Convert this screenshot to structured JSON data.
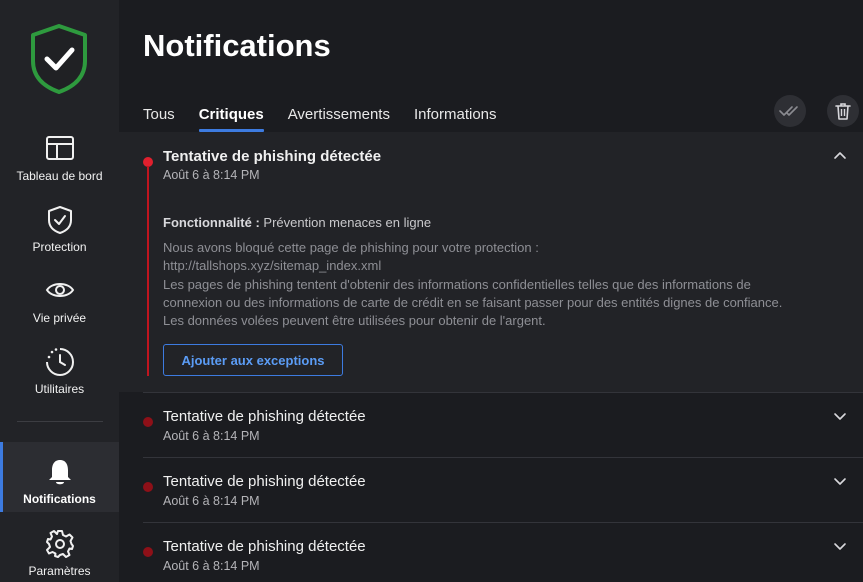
{
  "sidebar": {
    "items": [
      {
        "label": "Tableau de bord",
        "icon": "dashboard-icon"
      },
      {
        "label": "Protection",
        "icon": "shield-check-icon"
      },
      {
        "label": "Vie privée",
        "icon": "eye-icon"
      },
      {
        "label": "Utilitaires",
        "icon": "clock-tools-icon"
      },
      {
        "label": "Notifications",
        "icon": "bell-icon",
        "active": true
      },
      {
        "label": "Paramètres",
        "icon": "gear-icon"
      }
    ]
  },
  "page": {
    "title": "Notifications"
  },
  "tabs": [
    {
      "label": "Tous"
    },
    {
      "label": "Critiques",
      "active": true
    },
    {
      "label": "Avertissements"
    },
    {
      "label": "Informations"
    }
  ],
  "actions": {
    "mark_all_read": "double-check-icon",
    "delete_all": "trash-icon"
  },
  "notifications": [
    {
      "title": "Tentative de phishing détectée",
      "date": "Août 6 à 8:14 PM",
      "expanded": true,
      "feature_label": "Fonctionnalité :",
      "feature_value": "Prévention menaces en ligne",
      "description": [
        "Nous avons bloqué cette page de phishing pour votre protection :",
        "http://tallshops.xyz/sitemap_index.xml",
        "Les pages de phishing tentent d'obtenir des informations confidentielles telles que des informations de",
        "connexion ou des informations de carte de crédit en se faisant passer pour des entités dignes de confiance.",
        "Les données volées peuvent être utilisées pour obtenir de l'argent."
      ],
      "action_label": "Ajouter aux exceptions"
    },
    {
      "title": "Tentative de phishing détectée",
      "date": "Août 6 à 8:14 PM"
    },
    {
      "title": "Tentative de phishing détectée",
      "date": "Août 6 à 8:14 PM"
    },
    {
      "title": "Tentative de phishing détectée",
      "date": "Août 6 à 8:14 PM"
    }
  ],
  "colors": {
    "accent": "#3d7be0",
    "critical": "#e0202e",
    "critical_dim": "#8e1018",
    "logo_green": "#2e9a3e"
  }
}
